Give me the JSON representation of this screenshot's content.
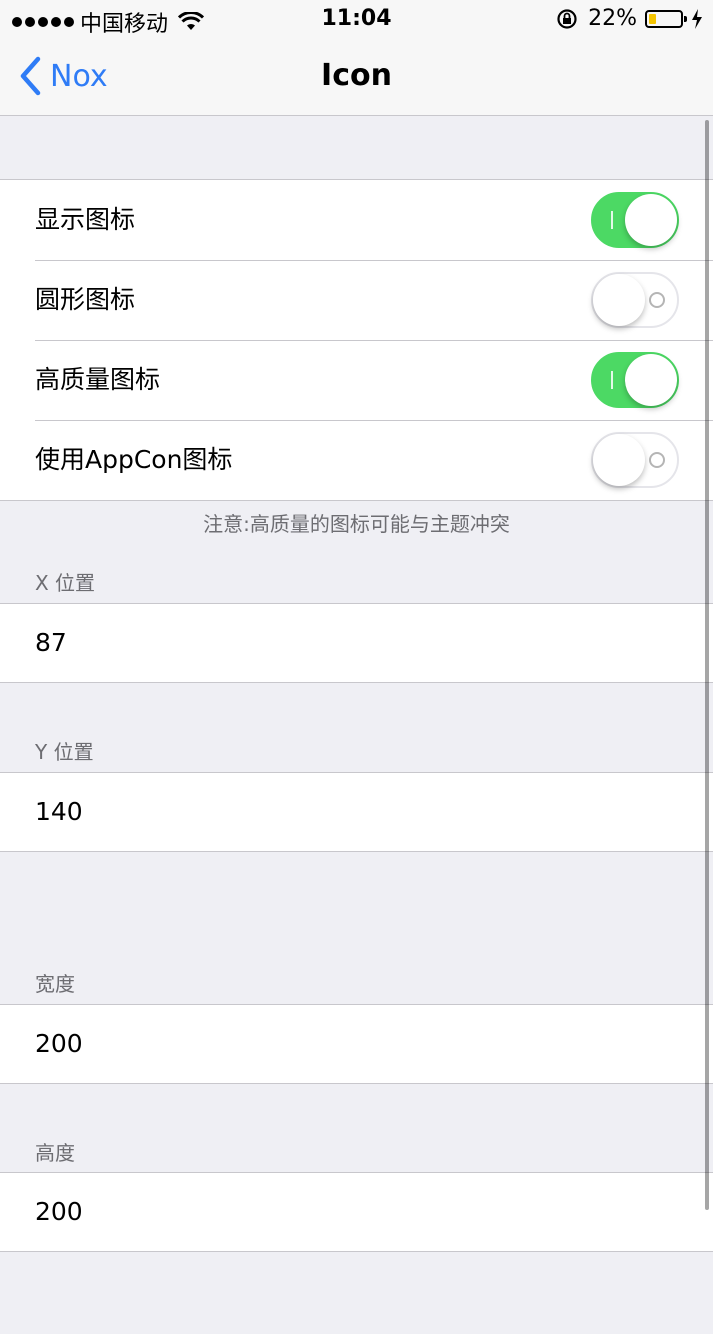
{
  "status_bar": {
    "carrier": "中国移动",
    "time": "11:04",
    "battery": "22%",
    "battery_level": 0.22
  },
  "nav": {
    "back_label": "Nox",
    "title": "Icon"
  },
  "settings": [
    {
      "label": "显示图标",
      "on": true
    },
    {
      "label": "圆形图标",
      "on": false
    },
    {
      "label": "高质量图标",
      "on": true
    },
    {
      "label": "使用AppCon图标",
      "on": false
    }
  ],
  "note": "注意:高质量的图标可能与主题冲突",
  "fields": {
    "x": {
      "header": "X 位置",
      "value": "87"
    },
    "y": {
      "header": "Y 位置",
      "value": "140"
    },
    "width": {
      "header": "宽度",
      "value": "200"
    },
    "height": {
      "header": "高度",
      "value": "200"
    }
  },
  "colors": {
    "accent": "#2f7cf6",
    "toggle_on": "#4cd964",
    "background": "#efeff4"
  }
}
